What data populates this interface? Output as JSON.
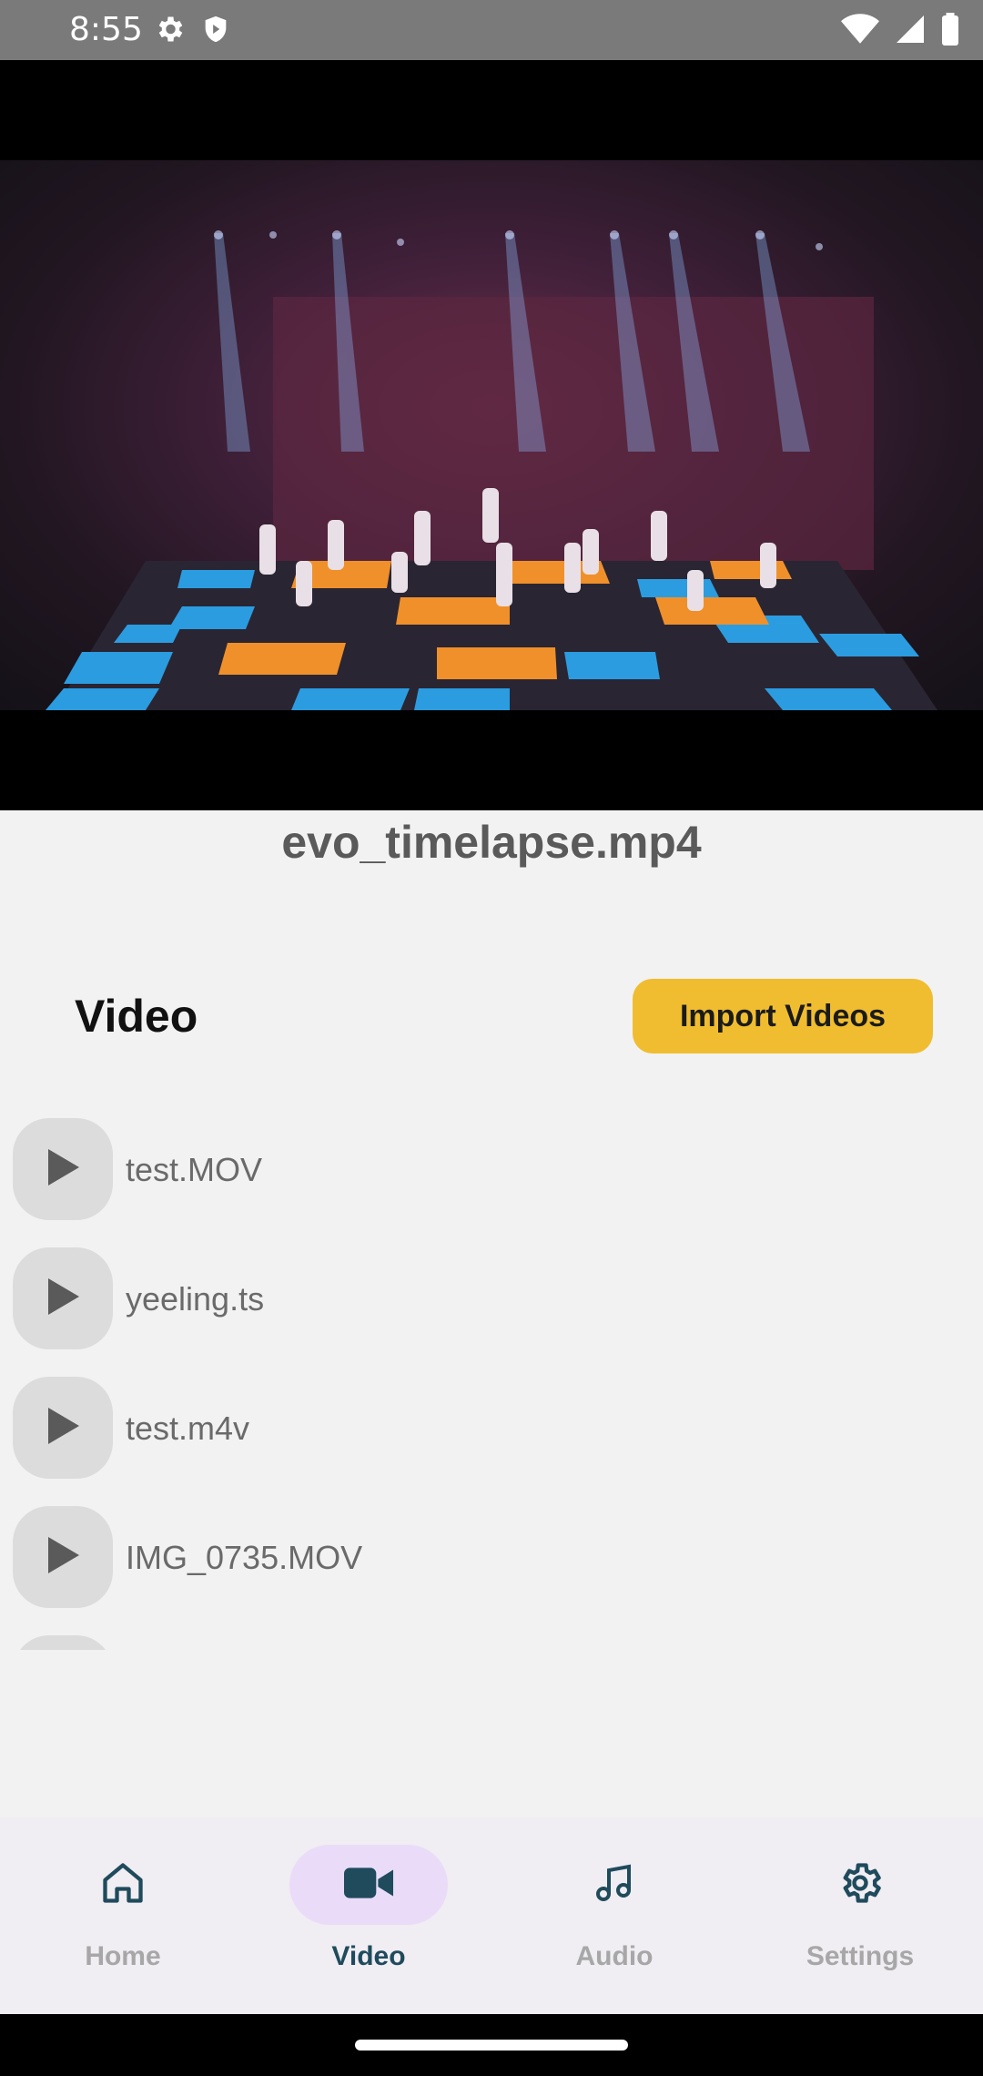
{
  "status_bar": {
    "time": "8:55",
    "icons": [
      "gear-icon",
      "shield-icon",
      "wifi-icon",
      "signal-icon",
      "battery-icon"
    ]
  },
  "player": {
    "title": "evo_timelapse.mp4"
  },
  "section": {
    "heading": "Video",
    "import_label": "Import Videos",
    "accent_color": "#f0bd30"
  },
  "videos": [
    {
      "name": "test.MOV",
      "icon": "play-icon"
    },
    {
      "name": "yeeling.ts",
      "icon": "play-icon"
    },
    {
      "name": "test.m4v",
      "icon": "play-icon"
    },
    {
      "name": "IMG_0735.MOV",
      "icon": "play-icon"
    }
  ],
  "nav": {
    "items": [
      {
        "label": "Home",
        "icon": "home-icon",
        "active": false
      },
      {
        "label": "Video",
        "icon": "video-camera-icon",
        "active": true
      },
      {
        "label": "Audio",
        "icon": "music-note-icon",
        "active": false
      },
      {
        "label": "Settings",
        "icon": "settings-gear-icon",
        "active": false
      }
    ],
    "active_color": "#1f4b5c",
    "active_pill_color": "#eadcf8"
  }
}
